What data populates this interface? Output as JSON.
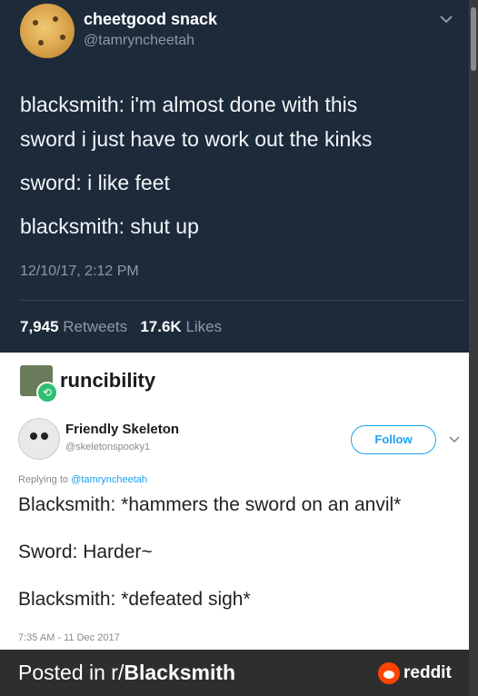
{
  "tweet1": {
    "display_name": "cheetgood snack",
    "handle": "@tamryncheetah",
    "lines": [
      "blacksmith: i'm almost done with this",
      "sword i just have to work out the kinks",
      "sword: i like feet",
      "blacksmith: shut up"
    ],
    "timestamp": "12/10/17, 2:12 PM",
    "retweets_count": "7,945",
    "retweets_label": "Retweets",
    "likes_count": "17.6K",
    "likes_label": "Likes"
  },
  "retweeter": {
    "name": "runcibility"
  },
  "tweet2": {
    "display_name": "Friendly Skeleton",
    "handle": "@skeletonspooky1",
    "follow_label": "Follow",
    "replying_prefix": "Replying to",
    "replying_handle": "@tamryncheetah",
    "lines": [
      "Blacksmith: *hammers the sword on an anvil*",
      "Sword: Harder~",
      "Blacksmith: *defeated sigh*"
    ],
    "timestamp": "7:35 AM - 11 Dec 2017"
  },
  "footer": {
    "posted_prefix": "Posted in r/",
    "subreddit": "Blacksmith",
    "brand": "reddit"
  },
  "colors": {
    "dark_bg": "#1c2a3a",
    "twitter_blue": "#1da1f2",
    "retweet_green": "#2fbf71",
    "reddit_orange": "#ff4500"
  }
}
